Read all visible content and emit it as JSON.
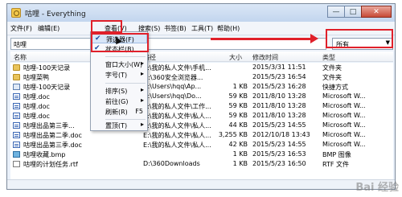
{
  "window": {
    "title": "咕哩 - Everything"
  },
  "window_buttons": {
    "minimize": "—",
    "maximize": "□",
    "close": "✕"
  },
  "menu": [
    {
      "label": "文件(F)"
    },
    {
      "label": "编辑(E)"
    },
    {
      "label": "查看(V)"
    },
    {
      "label": "搜索(S)"
    },
    {
      "label": "书签(B)"
    },
    {
      "label": "工具(T)"
    },
    {
      "label": "帮助(H)"
    }
  ],
  "search": {
    "value": "咕哩",
    "filter": "所有"
  },
  "columns": {
    "name": "名称",
    "path": "路径",
    "size": "大小",
    "modified": "修改时间",
    "type": "类型"
  },
  "rows": [
    {
      "icon": "folder-icon",
      "name": "咕哩-100天记录",
      "path": "E:\\我的私人文件\\手机...",
      "size": "",
      "modified": "2015/3/31 11:51",
      "type": "文件夹"
    },
    {
      "icon": "folder-icon",
      "name": "咕哩菜鸭",
      "path": "D:\\360安全浏览器...",
      "size": "",
      "modified": "2015/5/23 16:54",
      "type": "文件夹"
    },
    {
      "icon": "lnk-icon",
      "name": "咕哩-100天记录",
      "path": "C:\\Users\\hqq\\Ap...",
      "size": "1 KB",
      "modified": "2015/5/23 16:28",
      "type": "快捷方式"
    },
    {
      "icon": "doc-icon",
      "name": "咕哩.doc",
      "path": "C:\\Users\\hqq\\Do...",
      "size": "59 KB",
      "modified": "2011/8/10 13:28",
      "type": "Microsoft W..."
    },
    {
      "icon": "doc-icon",
      "name": "咕哩.doc",
      "path": "E:\\我的私人文件\\工作...",
      "size": "59 KB",
      "modified": "2011/8/10 13:28",
      "type": "Microsoft W..."
    },
    {
      "icon": "doc-icon",
      "name": "咕哩.doc",
      "path": "E:\\我的私人文件\\私人...",
      "size": "59 KB",
      "modified": "2011/8/10 13:28",
      "type": "Microsoft W..."
    },
    {
      "icon": "doc-icon",
      "name": "咕哩出品第三季...",
      "path": "E:\\我的私人文件\\私人...",
      "size": "44 KB",
      "modified": "2015/5/23 14:55",
      "type": "Microsoft W..."
    },
    {
      "icon": "doc-icon",
      "name": "咕哩出品第二季.doc",
      "path": "E:\\我的私人文件\\私人...",
      "size": "3,255 KB",
      "modified": "2012/10/18 13:43",
      "type": "Microsoft W..."
    },
    {
      "icon": "doc-icon",
      "name": "咕哩出品第三季.doc",
      "path": "E:\\我的私人文件\\私人...",
      "size": "42 KB",
      "modified": "2015/5/23 14:55",
      "type": "Microsoft W..."
    },
    {
      "icon": "bmp-icon",
      "name": "咕哩收藏.bmp",
      "path": "",
      "size": "1 KB",
      "modified": "2015/5/23 16:53",
      "type": "BMP 图像"
    },
    {
      "icon": "rtf-icon",
      "name": "咕哩的计划任务.rtf",
      "path": "D:\\360Downloads",
      "size": "1 KB",
      "modified": "2015/5/23 16:50",
      "type": "RTF 文件"
    }
  ],
  "view_menu": [
    {
      "label": "筛选器(F)",
      "checked": true,
      "highlighted": true
    },
    {
      "label": "状态栏(B)",
      "checked": true
    },
    {
      "label": "窗口大小(W)",
      "submenu": true
    },
    {
      "label": "字号(T)",
      "submenu": true
    },
    {
      "label": "排序(S)",
      "submenu": true
    },
    {
      "label": "前往(G)",
      "submenu": true
    },
    {
      "label": "刷新(R)",
      "shortcut": "F5"
    },
    {
      "label": "置顶(T)",
      "submenu": true
    }
  ],
  "watermark": "Bai 经验",
  "colors": {
    "annotation": "#e0202a",
    "selection": "#d8e6f8"
  }
}
